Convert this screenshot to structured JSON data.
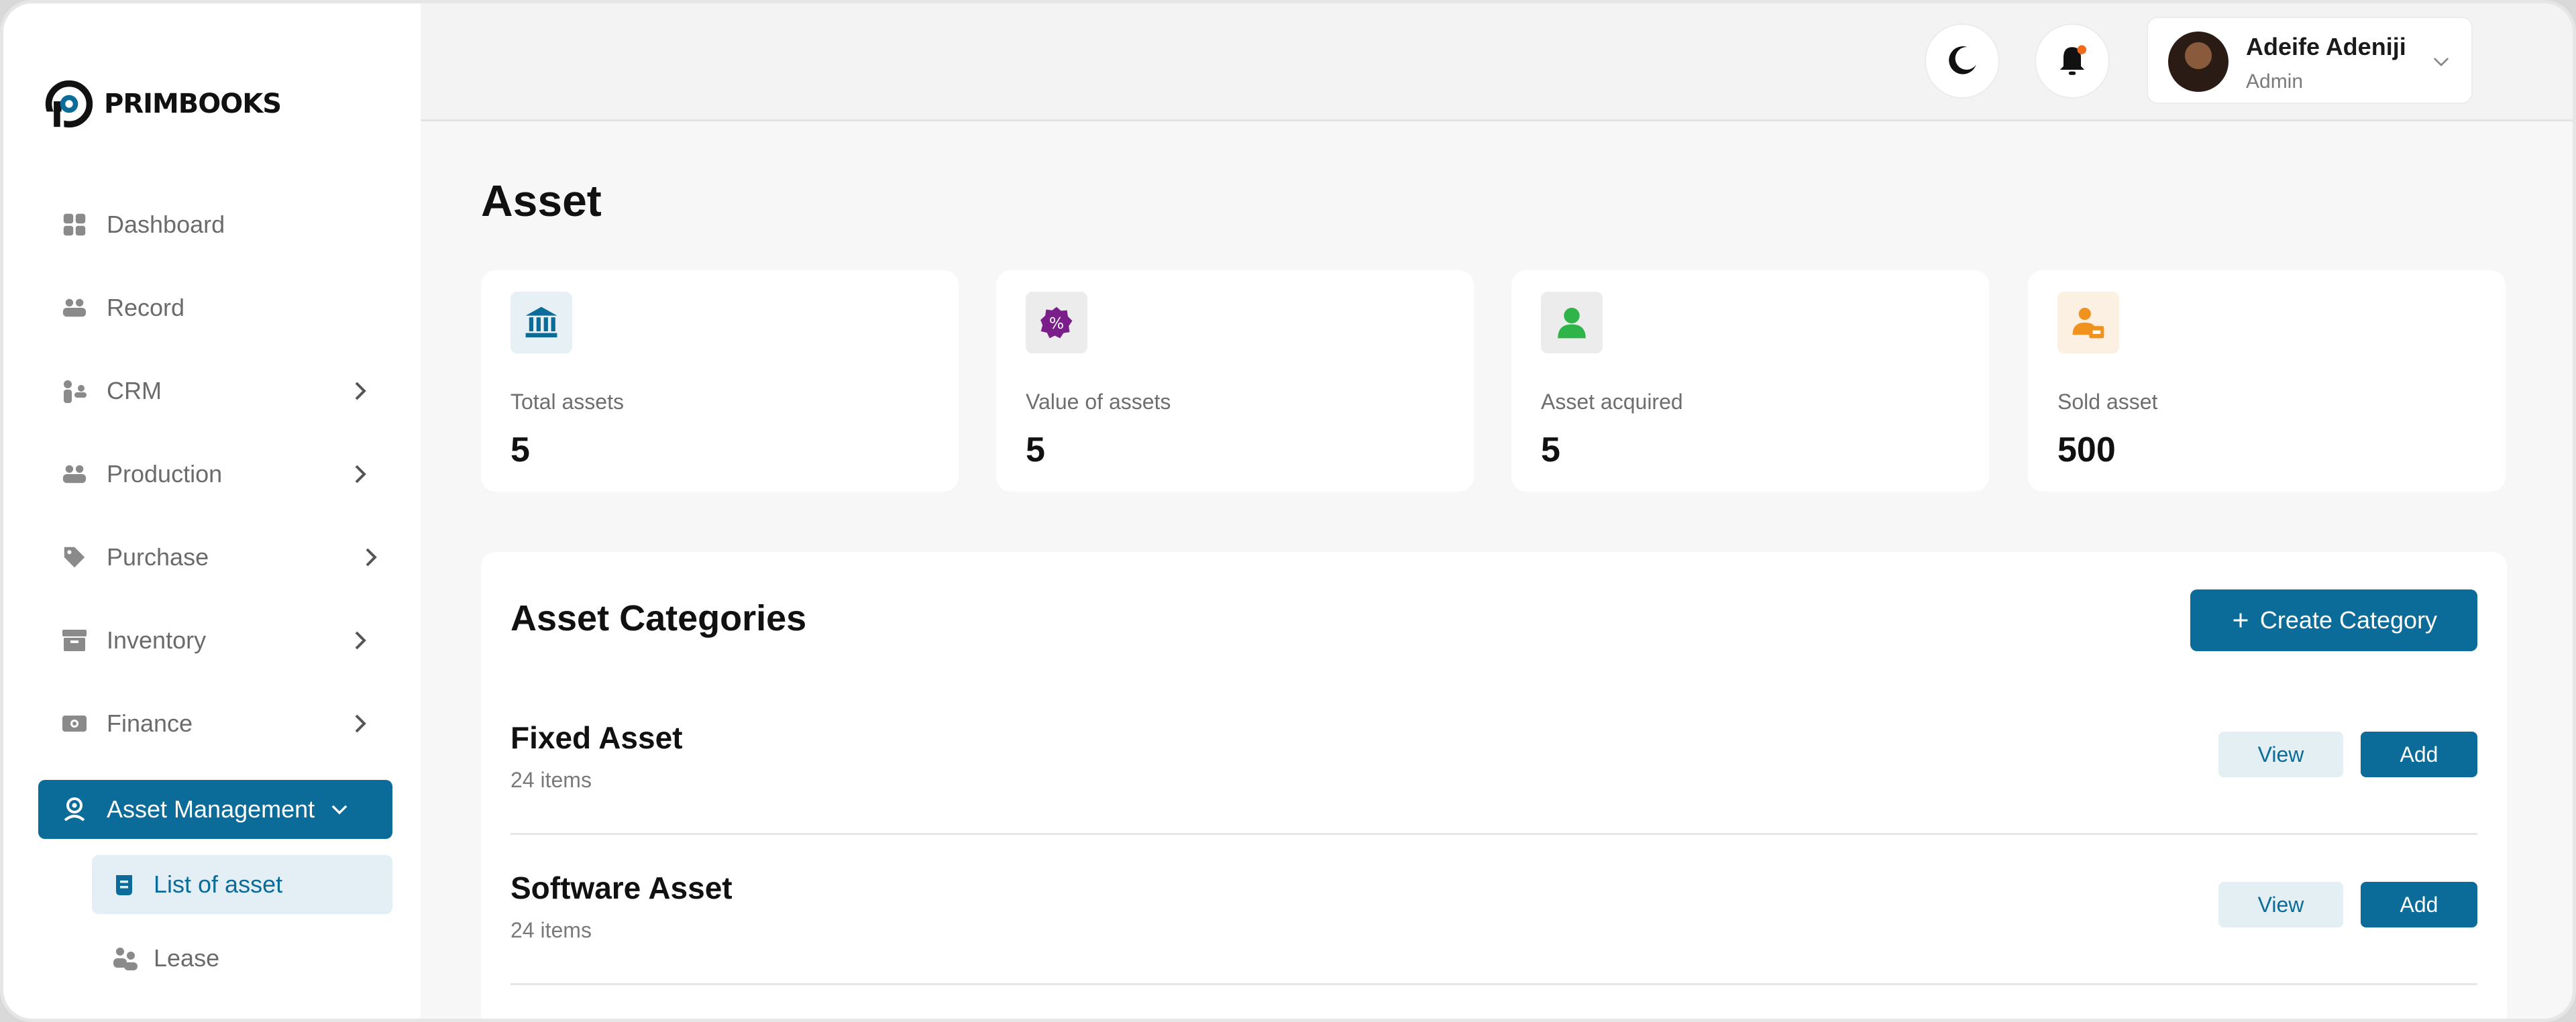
{
  "app": {
    "logo_text": "PRIMBOOKS"
  },
  "colors": {
    "primary": "#0b6b99",
    "notification_dot": "#f26a1b"
  },
  "sidebar": {
    "items": [
      {
        "label": "Dashboard",
        "icon": "grid-icon",
        "has_chevron": false
      },
      {
        "label": "Record",
        "icon": "people-icon",
        "has_chevron": false
      },
      {
        "label": "CRM",
        "icon": "users-icon",
        "has_chevron": true
      },
      {
        "label": "Production",
        "icon": "people-icon",
        "has_chevron": true
      },
      {
        "label": "Purchase",
        "icon": "tag-icon",
        "has_chevron": true
      },
      {
        "label": "Inventory",
        "icon": "archive-icon",
        "has_chevron": true
      },
      {
        "label": "Finance",
        "icon": "money-icon",
        "has_chevron": true
      },
      {
        "label": "Asset Management",
        "icon": "asset-icon",
        "active": true,
        "expanded": true
      }
    ],
    "sub_items": [
      {
        "label": "List of asset",
        "icon": "list-icon",
        "active": true
      },
      {
        "label": "Lease",
        "icon": "lease-icon"
      }
    ]
  },
  "header": {
    "user": {
      "name": "Adeife Adeniji",
      "role": "Admin"
    }
  },
  "page": {
    "title": "Asset"
  },
  "stats": [
    {
      "label": "Total assets",
      "value": "5",
      "icon": "bank-icon",
      "icon_bg": "#e6f0f5",
      "icon_color": "#0b6b99"
    },
    {
      "label": "Value of assets",
      "value": "5",
      "icon": "percent-badge-icon",
      "icon_bg": "#ececec",
      "icon_color": "#7a1f8a"
    },
    {
      "label": "Asset acquired",
      "value": "5",
      "icon": "user-icon",
      "icon_bg": "#ececec",
      "icon_color": "#2fb44a"
    },
    {
      "label": "Sold asset",
      "value": "500",
      "icon": "user-sale-icon",
      "icon_bg": "#fbf0e1",
      "icon_color": "#f0931e"
    }
  ],
  "categories": {
    "title": "Asset Categories",
    "create_label": "Create Category",
    "view_label": "View",
    "add_label": "Add",
    "rows": [
      {
        "name": "Fixed Asset",
        "count": "24 items"
      },
      {
        "name": "Software Asset",
        "count": "24 items"
      }
    ]
  }
}
